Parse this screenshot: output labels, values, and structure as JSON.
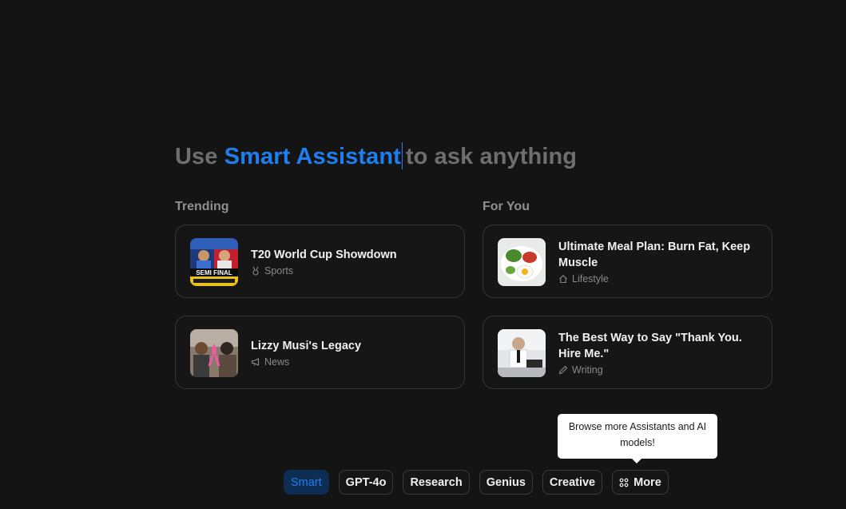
{
  "headline": {
    "prefix": "Use ",
    "highlight": "Smart Assistant",
    "suffix": "to ask anything"
  },
  "sections": {
    "trending": "Trending",
    "for_you": "For You"
  },
  "cards": [
    {
      "title": "T20 World Cup Showdown",
      "tag": "Sports",
      "tag_icon": "medal-icon",
      "thumb_text": "SEMI FINAL"
    },
    {
      "title": "Lizzy Musi's Legacy",
      "tag": "News",
      "tag_icon": "megaphone-icon"
    },
    {
      "title": "Ultimate Meal Plan: Burn Fat, Keep Muscle",
      "tag": "Lifestyle",
      "tag_icon": "home-icon"
    },
    {
      "title": "The Best Way to Say \"Thank You. Hire Me.\"",
      "tag": "Writing",
      "tag_icon": "pencil-icon"
    }
  ],
  "tooltip": {
    "text": "Browse more Assistants and AI models!"
  },
  "modes": [
    {
      "label": "Smart",
      "active": true
    },
    {
      "label": "GPT-4o",
      "active": false
    },
    {
      "label": "Research",
      "active": false
    },
    {
      "label": "Genius",
      "active": false
    },
    {
      "label": "Creative",
      "active": false
    },
    {
      "label": "More",
      "active": false,
      "icon": "grid-icon"
    }
  ],
  "colors": {
    "background": "#141414",
    "accent": "#1f7ff0",
    "muted": "#6e6e6e"
  }
}
